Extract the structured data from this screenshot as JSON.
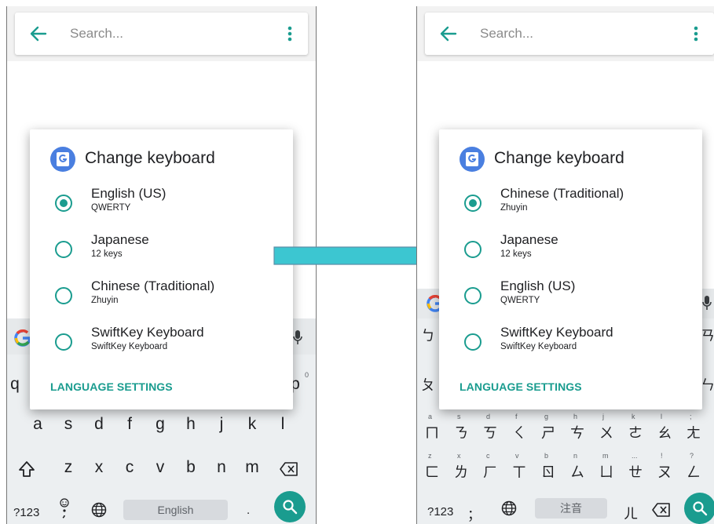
{
  "colors": {
    "accent": "#1a9c8f",
    "arrow": "#3cc6d1",
    "keyboard_bg": "#eceff1"
  },
  "left": {
    "search": {
      "placeholder": "Search..."
    },
    "dialog": {
      "title": "Change keyboard",
      "options": [
        {
          "name": "English (US)",
          "sub": "QWERTY",
          "checked": true
        },
        {
          "name": "Japanese",
          "sub": "12 keys",
          "checked": false
        },
        {
          "name": "Chinese (Traditional)",
          "sub": "Zhuyin",
          "checked": false
        },
        {
          "name": "SwiftKey Keyboard",
          "sub": "SwiftKey Keyboard",
          "checked": false
        }
      ],
      "settings_label": "LANGUAGE SETTINGS"
    },
    "keyboard": {
      "row1_left": "q",
      "row1_right": "p",
      "row1_right_sup": "0",
      "row2": [
        "a",
        "s",
        "d",
        "f",
        "g",
        "h",
        "j",
        "k",
        "l"
      ],
      "row3": [
        "z",
        "x",
        "c",
        "v",
        "b",
        "n",
        "m"
      ],
      "symbols_key": "?123",
      "space_label": "English",
      "period_key": "."
    }
  },
  "right": {
    "search": {
      "placeholder": "Search..."
    },
    "dialog": {
      "title": "Change keyboard",
      "options": [
        {
          "name": "Chinese (Traditional)",
          "sub": "Zhuyin",
          "checked": true
        },
        {
          "name": "Japanese",
          "sub": "12 keys",
          "checked": false
        },
        {
          "name": "English (US)",
          "sub": "QWERTY",
          "checked": false
        },
        {
          "name": "SwiftKey Keyboard",
          "sub": "SwiftKey Keyboard",
          "checked": false
        }
      ],
      "settings_label": "LANGUAGE SETTINGS"
    },
    "keyboard": {
      "row1_left": "ㄅ",
      "row1_right": "ㄢ",
      "row2_left": "ㄆ",
      "row2_right": "ㄣ",
      "row3": [
        "ㄇ",
        "ㄋ",
        "ㄎ",
        "ㄑ",
        "ㄕ",
        "ㄘ",
        "ㄨ",
        "ㄜ",
        "ㄠ",
        "ㄤ"
      ],
      "row3_sup": [
        "a",
        "s",
        "d",
        "f",
        "g",
        "h",
        "j",
        "k",
        "l",
        ";"
      ],
      "row4": [
        "ㄈ",
        "ㄌ",
        "ㄏ",
        "ㄒ",
        "ㄖ",
        "ㄙ",
        "ㄩ",
        "ㄝ",
        "ㄡ",
        "ㄥ"
      ],
      "row4_sup": [
        "z",
        "x",
        "c",
        "v",
        "b",
        "n",
        "m",
        "...",
        "!",
        "?"
      ],
      "symbols_key": "?123",
      "punct_key": "；",
      "space_label": "注音",
      "er_key": "ㄦ"
    }
  }
}
